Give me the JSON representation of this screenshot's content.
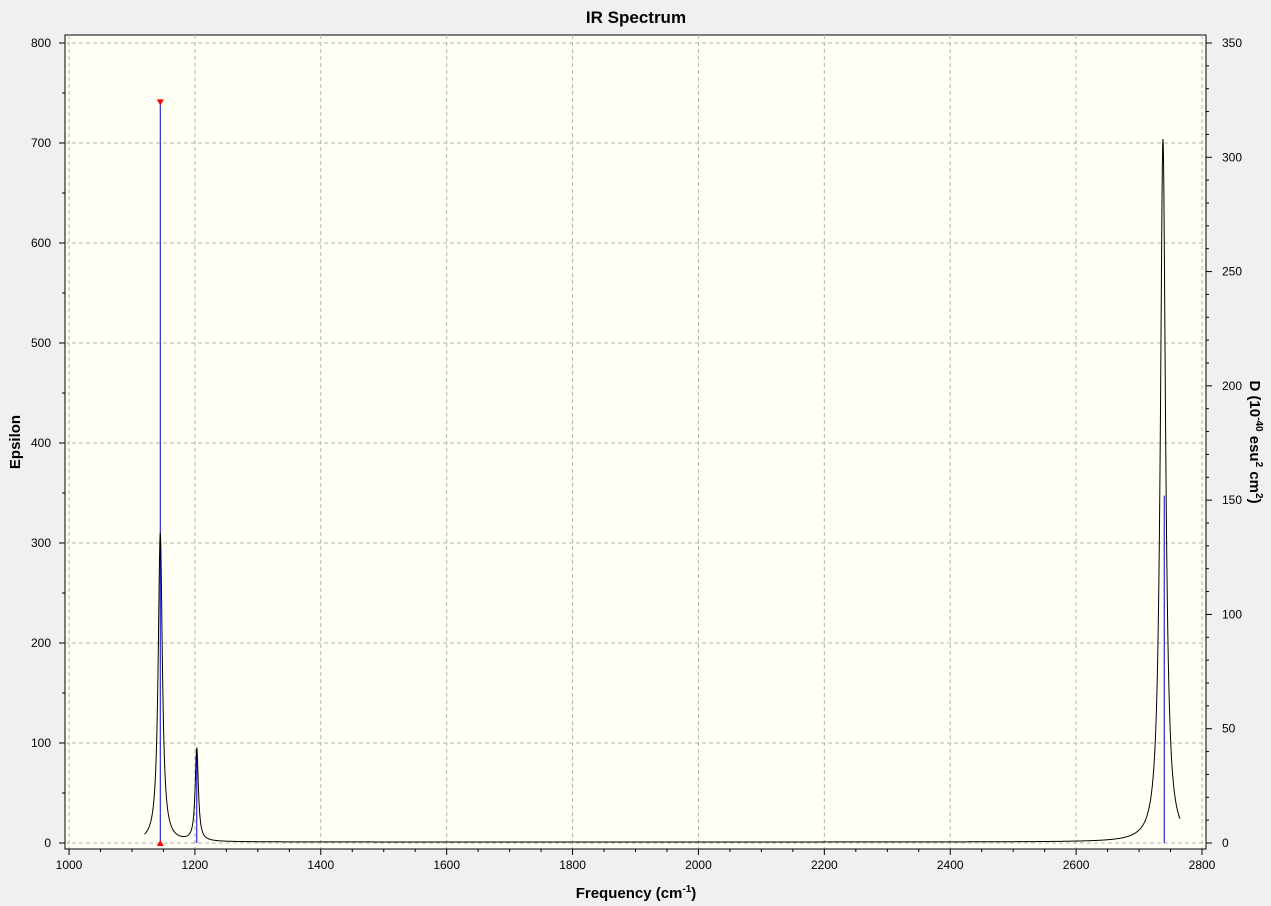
{
  "chart_data": {
    "type": "line",
    "title": "IR Spectrum",
    "xlabel": {
      "text": "Frequency (cm",
      "sup": "-1",
      "suffix": ")"
    },
    "ylabel_left": "Epsilon",
    "ylabel_right": {
      "parts": [
        "D (10",
        "-40",
        " esu",
        "2",
        " cm",
        "2",
        ")"
      ]
    },
    "xlim": [
      1000,
      2800
    ],
    "ylim_left": [
      0,
      800
    ],
    "ylim_right": [
      0,
      350
    ],
    "x_ticks": [
      1000,
      1200,
      1400,
      1600,
      1800,
      2000,
      2200,
      2400,
      2600,
      2800
    ],
    "y_ticks_left": [
      0,
      100,
      200,
      300,
      400,
      500,
      600,
      700,
      800
    ],
    "y_ticks_right": [
      0,
      50,
      100,
      150,
      200,
      250,
      300,
      350
    ],
    "grid": true,
    "colors": {
      "plot_bg": "#fffff6",
      "page_bg": "#f0f0f0",
      "spectrum": "#000000",
      "sticks": "#0000cc",
      "marker": "#ff0000",
      "grid": "#b4b4b4"
    },
    "peaks": [
      {
        "x": 1145,
        "epsilon": 309,
        "width": 8
      },
      {
        "x": 1203,
        "epsilon": 93,
        "width": 6
      },
      {
        "x": 2738,
        "epsilon": 703,
        "width": 10
      }
    ],
    "baseline_offset": 1,
    "spectrum_range": [
      1120,
      2765
    ],
    "sticks": [
      {
        "x": 1145,
        "d": 324
      },
      {
        "x": 1203,
        "d": 41
      },
      {
        "x": 2740,
        "d": 152
      }
    ],
    "selected_stick_x": 1145
  }
}
